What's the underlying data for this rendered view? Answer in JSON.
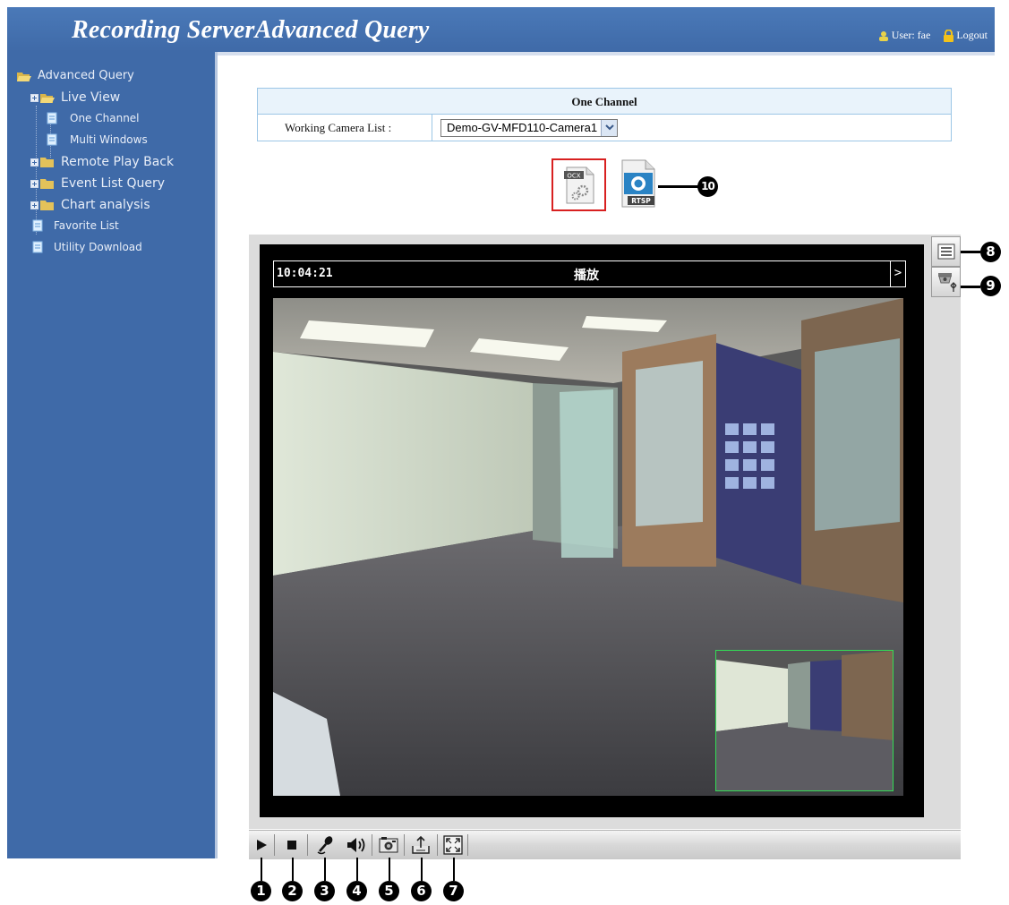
{
  "header": {
    "title": "Recording ServerAdvanced Query",
    "user_label": "User: fae",
    "logout_label": "Logout"
  },
  "sidebar": {
    "root": "Advanced Query",
    "items": [
      {
        "label": "Live View",
        "expandable": true,
        "icon": "folder-open-icon"
      },
      {
        "label": "One Channel",
        "expandable": false,
        "icon": "page-icon"
      },
      {
        "label": "Multi Windows",
        "expandable": false,
        "icon": "page-icon"
      },
      {
        "label": "Remote Play Back",
        "expandable": true,
        "icon": "folder-icon"
      },
      {
        "label": "Event List Query",
        "expandable": true,
        "icon": "folder-icon"
      },
      {
        "label": "Chart analysis",
        "expandable": true,
        "icon": "folder-icon"
      },
      {
        "label": "Favorite List",
        "expandable": false,
        "icon": "page-icon"
      },
      {
        "label": "Utility Download",
        "expandable": false,
        "icon": "page-icon"
      }
    ]
  },
  "channel": {
    "heading": "One Channel",
    "camera_list_label": "Working Camera List :",
    "camera_selected": "Demo-GV-MFD110-Camera1"
  },
  "plugins": {
    "ocx_label": "OCX",
    "rtsp_label": "RTSP"
  },
  "viewer": {
    "time": "10:04:21",
    "status": "播放",
    "next": ">"
  },
  "callouts": {
    "c1": "1",
    "c2": "2",
    "c3": "3",
    "c4": "4",
    "c5": "5",
    "c6": "6",
    "c7": "7",
    "c8": "8",
    "c9": "9",
    "c10": "10"
  },
  "colors": {
    "header_bg": "#4a79b8",
    "sidebar_bg": "#3f6aa8",
    "table_border": "#9cc6e6",
    "table_head_bg": "#e9f3fb",
    "ocx_border": "#d82020",
    "pip_border": "#33dd55"
  },
  "toolbar": {
    "buttons": [
      "play-icon",
      "stop-icon",
      "microphone-icon",
      "speaker-icon",
      "snapshot-icon",
      "save-video-icon",
      "fullscreen-icon"
    ]
  }
}
